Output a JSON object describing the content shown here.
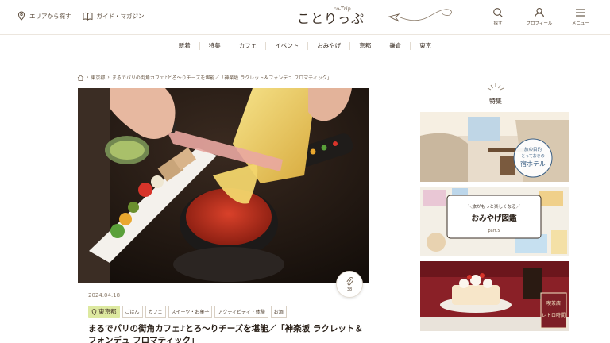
{
  "header": {
    "area_search": "エリアから探す",
    "guide": "ガイド・マガジン",
    "logo": "ことりっぷ",
    "logo_sup": "co-Trip",
    "search": "探す",
    "profile": "プロフィール",
    "menu": "メニュー"
  },
  "nav": [
    "新着",
    "特集",
    "カフェ",
    "イベント",
    "おみやげ",
    "京都",
    "鎌倉",
    "東京"
  ],
  "breadcrumb": {
    "area": "東京都",
    "article": "まるでパリの街角カフェ♪とろ〜りチーズを堪能／「神楽坂 ラクレット＆フォンデュ フロマティック」"
  },
  "article": {
    "clip_count": "38",
    "date": "2024.04.18",
    "area_tag": "東京都",
    "tags": [
      "ごはん",
      "カフェ",
      "スイーツ・お菓子",
      "アクティビティ・体験",
      "お酒"
    ],
    "title": "まるでパリの街角カフェ♪とろ〜りチーズを堪能／「神楽坂 ラクレット＆フォンデュ フロマティック」"
  },
  "sidebar": {
    "heading": "特集",
    "features": [
      {
        "line1": "旅の目的",
        "line2": "とっておきの",
        "line3": "宿ホテル"
      },
      {
        "line1": "＼旅がもっと楽しくなる／",
        "line2": "おみやげ図鑑",
        "line3": "part.5"
      },
      {
        "line1": "喫茶店",
        "line2": "レトロ時間"
      }
    ]
  },
  "colors": {
    "accent": "#dde9a0",
    "text": "#4a3b2c",
    "line": "#ece6de"
  }
}
